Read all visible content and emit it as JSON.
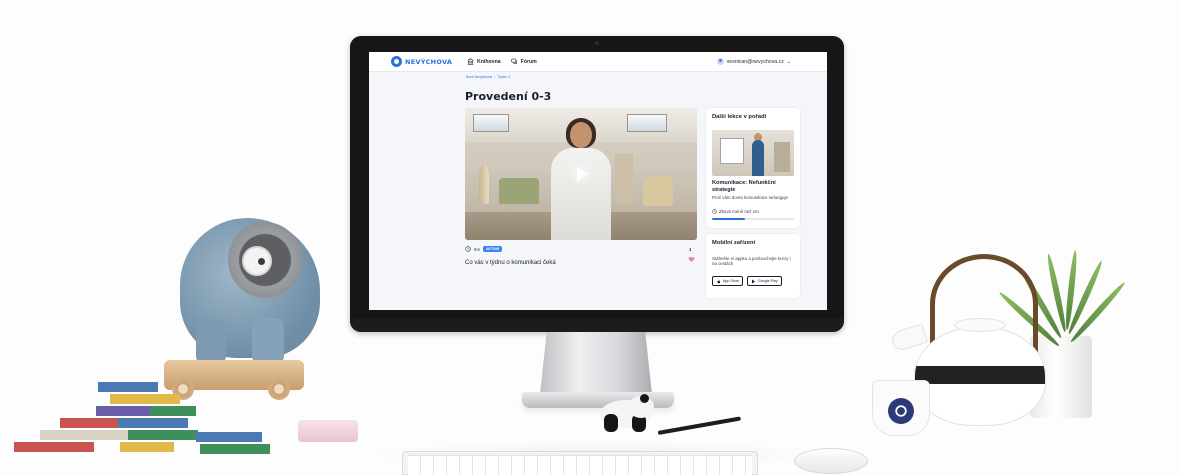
{
  "app": {
    "logo_text": "NEVÝCHOVA",
    "brand_color": "#2a6fdb"
  },
  "nav": {
    "items": [
      {
        "label": "Knihovna",
        "icon": "library-icon"
      },
      {
        "label": "Fórum",
        "icon": "forum-icon"
      }
    ]
  },
  "user": {
    "email": "vesnican@nevychova.cz",
    "icon": "user-avatar-icon"
  },
  "breadcrumb": {
    "items": [
      "Kurz Nevýchova",
      "Týden 1"
    ]
  },
  "page": {
    "title": "Provedení 0-3"
  },
  "video": {
    "duration": "8m",
    "badge": "AKTIVNÍ",
    "likes": "1",
    "description": "Co vás v týdnu o komunikaci čeká"
  },
  "next_lesson": {
    "heading": "Další lekce v pořadí",
    "title": "Komunikace: Nefunkční strategie",
    "description": "Proč vám doma komunikace nefunguje",
    "remaining": "Zbývá méně než 1m",
    "progress": 0.4
  },
  "mobile": {
    "heading": "Mobilní zařízení",
    "text": "Stáhněte si appku a poslouchejte kurzy i na cestách",
    "stores": [
      {
        "label": "App Store",
        "icon": "apple-icon"
      },
      {
        "label": "Google Play",
        "icon": "google-play-icon"
      }
    ]
  }
}
